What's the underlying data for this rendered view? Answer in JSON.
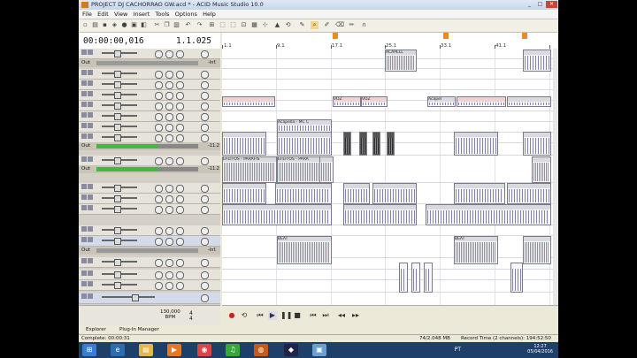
{
  "window": {
    "title": "PROJECT DJ CACHORRAO GW.acd * - ACID Music Studio 10.0",
    "controls": [
      "_",
      "□",
      "✕"
    ]
  },
  "menu": [
    "File",
    "Edit",
    "View",
    "Insert",
    "Tools",
    "Options",
    "Help"
  ],
  "time_display": {
    "timecode": "00:00:00,016",
    "measure_beat": "1.1.025"
  },
  "ruler": {
    "labels": [
      "1.1",
      "9.1",
      "17.1",
      "25.1",
      "33.1",
      "41.1"
    ]
  },
  "outputs": [
    {
      "label": "Out",
      "db": "-Inf."
    },
    {
      "label": "Out",
      "db": "-11.2"
    },
    {
      "label": "Out",
      "db": "-11.2"
    },
    {
      "label": "Out",
      "db": "-Inf."
    }
  ],
  "clips": {
    "acapella_top": "ACAPELL",
    "voz": "VOZ",
    "voz2": "VOZ",
    "acapella_mc": "Acapella - MC C",
    "acapella_right": "Acapel",
    "efeitos": "EFEITOS - PARAFIS",
    "efeitos2": "EFEITOS - PARA",
    "beat": "BEAT",
    "beat2": "BEAT"
  },
  "tempo": {
    "bpm": "130,000",
    "label": "BPM",
    "time_sig": "4",
    "beats": "4"
  },
  "tabs": [
    "Explorer",
    "Plug-In Manager"
  ],
  "status": {
    "left": "Complete: 00:00:31",
    "mem": "74/2.048 MB",
    "record": "Record Time (2 channels): 194:52:50"
  },
  "taskbar": {
    "lang": "PT",
    "time": "12:27",
    "date": "05/04/2016"
  },
  "colors": {
    "accent_orange": "#f08a1c",
    "meter_green": "#3dbb3d",
    "taskbar_blue": "#1f3f6b"
  }
}
